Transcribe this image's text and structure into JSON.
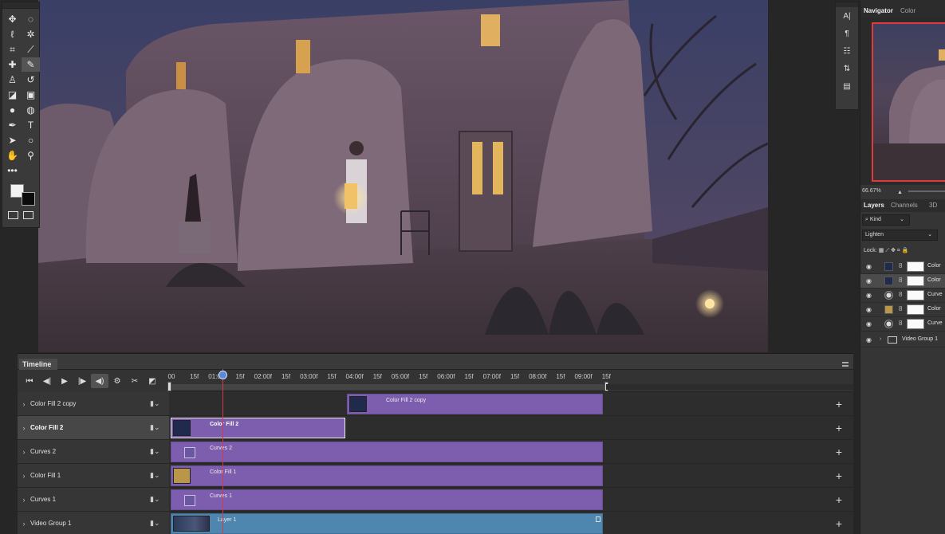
{
  "app": {
    "panels": {
      "navigator_tab": "Navigator",
      "color_tab": "Color",
      "layers_tab": "Layers",
      "channels_tab": "Channels",
      "threed_tab": "3D"
    }
  },
  "tools": {
    "items": [
      "move-icon",
      "marquee-icon",
      "lasso-icon",
      "magic-wand-icon",
      "crop-icon",
      "eyedropper-icon",
      "healing-brush-icon",
      "brush-icon",
      "clone-stamp-icon",
      "history-brush-icon",
      "eraser-icon",
      "gradient-icon",
      "blur-icon",
      "dodge-icon",
      "pen-icon",
      "type-icon",
      "path-select-icon",
      "ellipse-shape-icon",
      "hand-icon",
      "zoom-icon"
    ],
    "more": "•••",
    "foreground_color": "#f2f2f2",
    "background_color": "#0c0c0c"
  },
  "navigator": {
    "zoom": "66.67%"
  },
  "layers": {
    "filter_label": "Kind",
    "blend_mode": "Lighten",
    "lock_label": "Lock:",
    "rows": [
      {
        "name": "Color",
        "type": "navy"
      },
      {
        "name": "Color",
        "type": "navy",
        "selected": true
      },
      {
        "name": "Curve",
        "type": "curve"
      },
      {
        "name": "Color",
        "type": "gold"
      },
      {
        "name": "Curve",
        "type": "curve"
      }
    ],
    "group_name": "Video Group 1"
  },
  "timeline": {
    "tab_label": "Timeline",
    "ruler_ticks": [
      "00",
      "15f",
      "01:00f",
      "15f",
      "02:00f",
      "15f",
      "03:00f",
      "15f",
      "04:00f",
      "15f",
      "05:00f",
      "15f",
      "06:00f",
      "15f",
      "07:00f",
      "15f",
      "08:00f",
      "15f",
      "09:00f",
      "15f"
    ],
    "tracks": [
      {
        "name": "Color Fill 2 copy"
      },
      {
        "name": "Color Fill 2",
        "selected": true
      },
      {
        "name": "Curves 2"
      },
      {
        "name": "Color Fill 1"
      },
      {
        "name": "Curves 1"
      },
      {
        "name": "Video Group 1"
      }
    ],
    "clips": [
      {
        "label": "Color Fill 2 copy"
      },
      {
        "label": "Color Fill 2"
      },
      {
        "label": "Curves 2"
      },
      {
        "label": "Color Fill 1"
      },
      {
        "label": "Curves 1"
      },
      {
        "label": "Layer 1"
      }
    ],
    "add_symbol": "+"
  },
  "colors": {
    "clip_purple": "#7d5dae",
    "clip_video": "#4f86b0",
    "playhead": "#d63a4a",
    "nav_frame": "#e03a3a"
  }
}
